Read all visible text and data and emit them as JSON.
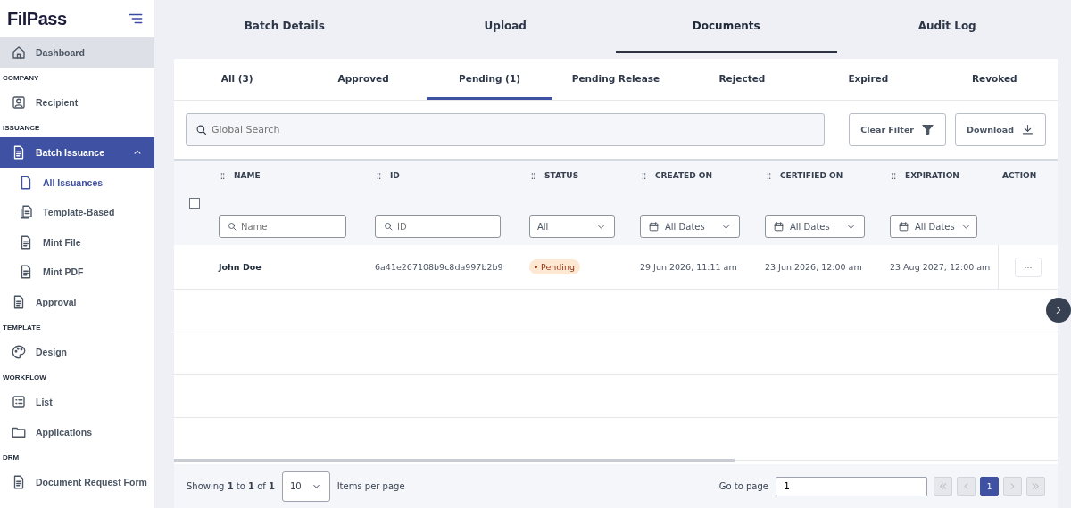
{
  "logo": {
    "text": "FilPass"
  },
  "sidebar": {
    "items": [
      {
        "kind": "item",
        "label": "Dashboard",
        "selected": false,
        "highlighted": true
      },
      {
        "kind": "section",
        "label": "COMPANY"
      },
      {
        "kind": "item",
        "label": "Recipient",
        "selected": false
      },
      {
        "kind": "section",
        "label": "ISSUANCE"
      },
      {
        "kind": "item",
        "label": "Batch Issuance",
        "selected": true,
        "expanded": true,
        "children": [
          {
            "label": "All Issuances",
            "selected": true
          },
          {
            "label": "Template-Based",
            "selected": false
          },
          {
            "label": "Mint File",
            "selected": false
          },
          {
            "label": "Mint PDF",
            "selected": false
          }
        ]
      },
      {
        "kind": "item",
        "label": "Approval",
        "selected": false
      },
      {
        "kind": "section",
        "label": "TEMPLATE"
      },
      {
        "kind": "item",
        "label": "Design",
        "selected": false
      },
      {
        "kind": "section",
        "label": "WORKFLOW"
      },
      {
        "kind": "item",
        "label": "List",
        "selected": false
      },
      {
        "kind": "item",
        "label": "Applications",
        "selected": false
      },
      {
        "kind": "section",
        "label": "DRM"
      },
      {
        "kind": "item",
        "label": "Document Request Form",
        "selected": false
      }
    ]
  },
  "tabs": [
    {
      "label": "Batch Details",
      "selected": false
    },
    {
      "label": "Upload",
      "selected": false
    },
    {
      "label": "Documents",
      "selected": true
    },
    {
      "label": "Audit Log",
      "selected": false
    }
  ],
  "subtabs": [
    {
      "label": "All (3)",
      "selected": false
    },
    {
      "label": "Approved",
      "selected": false
    },
    {
      "label": "Pending (1)",
      "selected": true
    },
    {
      "label": "Pending Release",
      "selected": false
    },
    {
      "label": "Rejected",
      "selected": false
    },
    {
      "label": "Expired",
      "selected": false
    },
    {
      "label": "Revoked",
      "selected": false
    }
  ],
  "search": {
    "placeholder": "Global Search"
  },
  "buttons": [
    {
      "label": "Clear Filter"
    },
    {
      "label": "Download"
    }
  ],
  "table": {
    "select_all_checked": false,
    "columns": [
      {
        "label": "NAME",
        "filter": {
          "kind": "text",
          "placeholder": "Name"
        }
      },
      {
        "label": "ID",
        "filter": {
          "kind": "text",
          "placeholder": "ID"
        }
      },
      {
        "label": "STATUS",
        "filter": {
          "kind": "select",
          "value": "All"
        }
      },
      {
        "label": "CREATED ON",
        "filter": {
          "kind": "date",
          "value": "All Dates"
        }
      },
      {
        "label": "CERTIFIED ON",
        "filter": {
          "kind": "date",
          "value": "All Dates"
        }
      },
      {
        "label": "EXPIRATION",
        "filter": {
          "kind": "date",
          "value": "All Dates"
        }
      },
      {
        "label": "ACTION",
        "kind": "action"
      }
    ],
    "rows": [
      {
        "name": "John Doe",
        "id": "6a41e267108b9c8da997b2b9",
        "status": "Pending",
        "created_on": "29 Jun 2026, 11:11 am",
        "certified_on": "23 Jun 2026, 12:00 am",
        "expiration": "23 Aug 2027, 12:00 am",
        "action": "···"
      }
    ]
  },
  "pagination": {
    "summary": "Showing **1** to **1** of **1**",
    "page_size": "10",
    "page_size_label": "Items per page",
    "go_to_label": "Go to page",
    "go_to_value": "1",
    "pages": [
      {
        "label": "1",
        "selected": true
      }
    ]
  }
}
